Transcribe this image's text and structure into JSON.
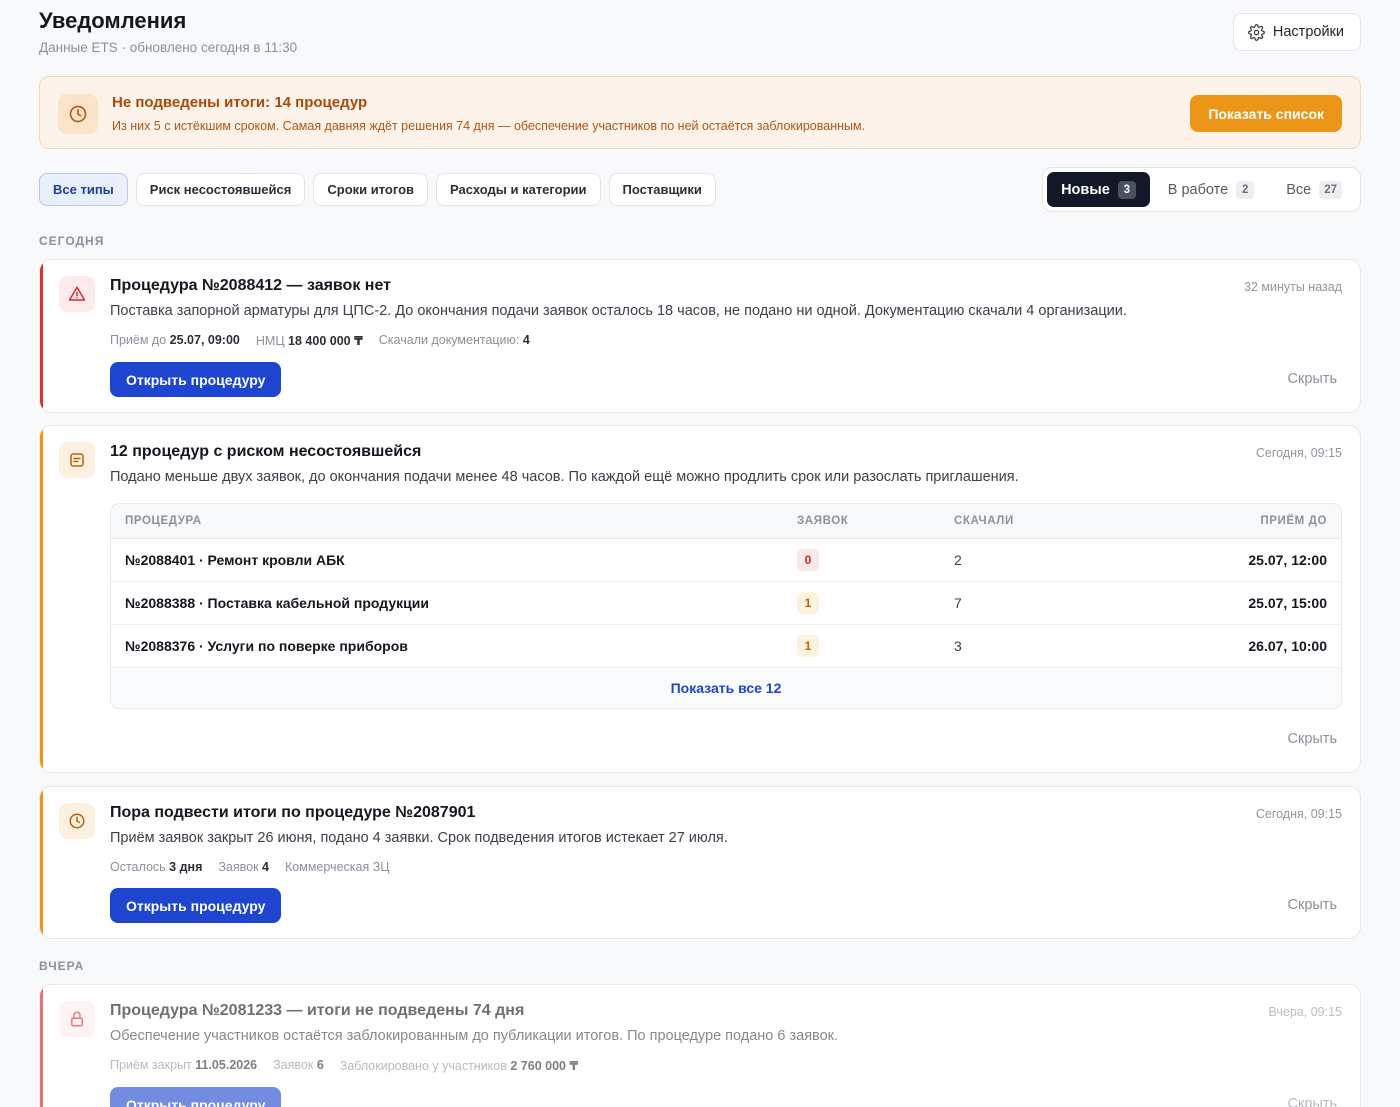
{
  "header": {
    "title": "Уведомления",
    "subtitle": "Данные ETS · обновлено сегодня в 11:30",
    "settings_label": "Настройки"
  },
  "banner": {
    "title": "Не подведены итоги: 14 процедур",
    "text": "Из них 5 с истёкшим сроком. Самая давняя ждёт решения 74 дня — обеспечение участников по ней остаётся заблокированным.",
    "button": "Показать список"
  },
  "filters": [
    "Все типы",
    "Риск несостоявшейся",
    "Сроки итогов",
    "Расходы и категории",
    "Поставщики"
  ],
  "segments": [
    {
      "label": "Новые",
      "count": "3"
    },
    {
      "label": "В работе",
      "count": "2"
    },
    {
      "label": "Все",
      "count": "27"
    }
  ],
  "sections": {
    "today": "СЕГОДНЯ",
    "yesterday": "ВЧЕРА"
  },
  "card1": {
    "title": "Процедура №2088412 — заявок нет",
    "desc": "Поставка запорной арматуры для ЦПС-2. До окончания подачи заявок осталось 18 часов, не подано ни одной. Документацию скачали 4 организации.",
    "time": "32 минуты назад",
    "meta": [
      {
        "label": "Приём до",
        "value": "25.07, 09:00"
      },
      {
        "label": "НМЦ",
        "value": "18 400 000 ₸"
      },
      {
        "label": "Скачали документацию:",
        "value": "4"
      }
    ],
    "button": "Открыть процедуру",
    "hide": "Скрыть"
  },
  "card2": {
    "title": "12 процедур с риском несостоявшейся",
    "desc": "Подано меньше двух заявок, до окончания подачи менее 48 часов. По каждой ещё можно продлить срок или разослать приглашения.",
    "time": "Сегодня, 09:15",
    "table": {
      "headers": [
        "ПРОЦЕДУРА",
        "ЗАЯВОК",
        "СКАЧАЛИ",
        "ПРИЁМ ДО"
      ],
      "rows": [
        {
          "name": "№2088401 · Ремонт кровли АБК",
          "bids": "0",
          "downloads": "2",
          "deadline": "25.07, 12:00"
        },
        {
          "name": "№2088388 · Поставка кабельной продукции",
          "bids": "1",
          "downloads": "7",
          "deadline": "25.07, 15:00"
        },
        {
          "name": "№2088376 · Услуги по поверке приборов",
          "bids": "1",
          "downloads": "3",
          "deadline": "26.07, 10:00"
        }
      ],
      "footer": "Показать все 12"
    },
    "hide": "Скрыть"
  },
  "card3": {
    "title": "Пора подвести итоги по процедуре №2087901",
    "desc": "Приём заявок закрыт 26 июня, подано 4 заявки. Срок подведения итогов истекает 27 июля.",
    "time": "Сегодня, 09:15",
    "meta": [
      {
        "label": "Осталось",
        "value": "3 дня"
      },
      {
        "label": "Заявок",
        "value": "4"
      },
      {
        "label": "Коммерческая ЗЦ",
        "value": ""
      }
    ],
    "button": "Открыть процедуру",
    "hide": "Скрыть"
  },
  "card4": {
    "title": "Процедура №2081233 — итоги не подведены 74 дня",
    "desc": "Обеспечение участников остаётся заблокированным до публикации итогов. По процедуре подано 6 заявок.",
    "time": "Вчера, 09:15",
    "meta": [
      {
        "label": "Приём закрыт",
        "value": "11.05.2026"
      },
      {
        "label": "Заявок",
        "value": "6"
      },
      {
        "label": "Заблокировано у участников",
        "value": "2 760 000 ₸"
      }
    ],
    "button": "Открыть процедуру",
    "hide": "Скрыть"
  },
  "colors": {
    "accent_blue": "#1d45cf",
    "danger": "#d32f2f",
    "warning": "#eb9619",
    "banner_bg": "#fdf3ea"
  }
}
